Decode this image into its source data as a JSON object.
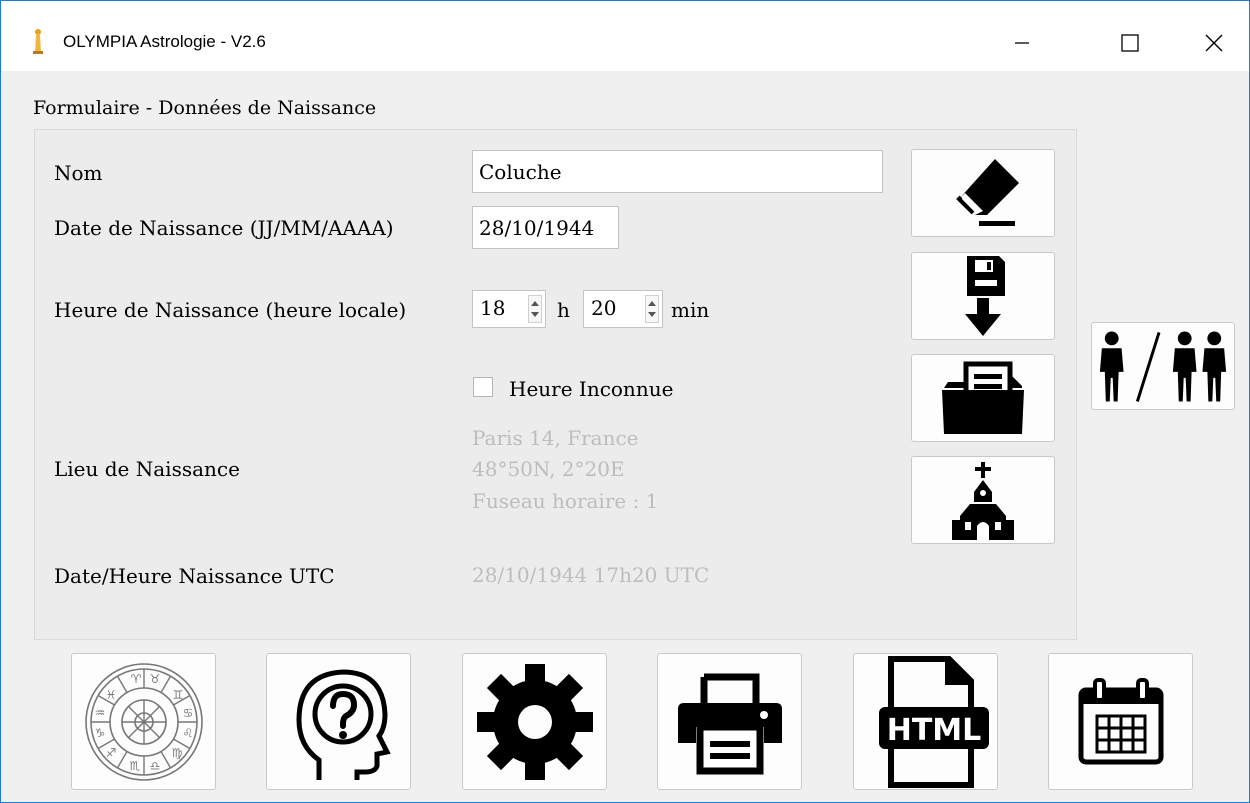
{
  "window": {
    "title": "OLYMPIA Astrologie - V2.6",
    "controls": [
      "minimize-icon",
      "maximize-icon",
      "close-icon"
    ],
    "border_color": "#1c7bd6"
  },
  "form": {
    "section_title": "Formulaire - Données de Naissance",
    "name": {
      "label": "Nom",
      "value": "Coluche"
    },
    "birth_date": {
      "label": "Date de Naissance (JJ/MM/AAAA)",
      "value": "28/10/1944"
    },
    "birth_time": {
      "label": "Heure de Naissance (heure locale)",
      "hour": "18",
      "hour_unit": "h",
      "minute": "20",
      "minute_unit": "min"
    },
    "unknown_time": {
      "label": "Heure Inconnue",
      "checked": false
    },
    "birth_place": {
      "label": "Lieu de Naissance",
      "city": "Paris 14, France",
      "coords": "48°50N, 2°20E",
      "timezone": "Fuseau horaire : 1"
    },
    "utc": {
      "label": "Date/Heure Naissance UTC",
      "value": "28/10/1944 17h20 UTC"
    }
  },
  "side_buttons": [
    "eraser-icon",
    "save-icon",
    "open-folder-icon",
    "church-icon"
  ],
  "people_button": "people-icon",
  "bottom_buttons": [
    "zodiac-wheel-icon",
    "help-head-icon",
    "gear-icon",
    "printer-icon",
    "html-file-icon",
    "calendar-icon"
  ],
  "colors": {
    "disabled_text": "#bdbdbd",
    "background": "#f0f0f0",
    "panel": "#ececec"
  }
}
